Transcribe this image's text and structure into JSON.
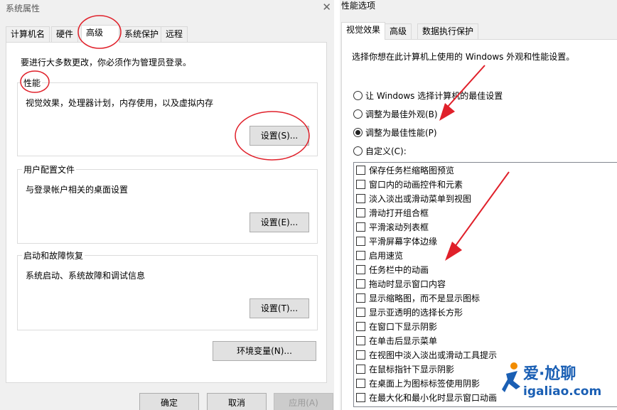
{
  "system_properties": {
    "title": "系统属性",
    "tabs": [
      "计算机名",
      "硬件",
      "高级",
      "系统保护",
      "远程"
    ],
    "admin_note": "要进行大多数更改，你必须作为管理员登录。",
    "performance": {
      "label": "性能",
      "description": "视觉效果，处理器计划，内存使用，以及虚拟内存",
      "button": "设置(S)..."
    },
    "user_profiles": {
      "label": "用户配置文件",
      "description": "与登录帐户相关的桌面设置",
      "button": "设置(E)..."
    },
    "startup_recovery": {
      "label": "启动和故障恢复",
      "description": "系统启动、系统故障和调试信息",
      "button": "设置(T)..."
    },
    "env_button": "环境变量(N)...",
    "footer": {
      "ok": "确定",
      "cancel": "取消",
      "apply": "应用(A)"
    }
  },
  "performance_options": {
    "title": "性能选项",
    "tabs": [
      "视觉效果",
      "高级",
      "数据执行保护"
    ],
    "intro": "选择你想在此计算机上使用的 Windows 外观和性能设置。",
    "radios": [
      {
        "label": "让 Windows 选择计算机的最佳设置",
        "checked": false
      },
      {
        "label": "调整为最佳外观(B)",
        "checked": false
      },
      {
        "label": "调整为最佳性能(P)",
        "checked": true
      },
      {
        "label": "自定义(C):",
        "checked": false
      }
    ],
    "options": [
      "保存任务栏缩略图预览",
      "窗口内的动画控件和元素",
      "淡入淡出或滑动菜单到视图",
      "滑动打开组合框",
      "平滑滚动列表框",
      "平滑屏幕字体边缘",
      "启用速览",
      "任务栏中的动画",
      "拖动时显示窗口内容",
      "显示缩略图，而不是显示图标",
      "显示亚透明的选择长方形",
      "在窗口下显示阴影",
      "在单击后显示菜单",
      "在视图中淡入淡出或滑动工具提示",
      "在鼠标指针下显示阴影",
      "在桌面上为图标标签使用阴影",
      "在最大化和最小化时显示窗口动画"
    ]
  },
  "watermark": {
    "text": "爱·尬聊",
    "url": "igaliao.com"
  },
  "colors": {
    "annotation_red": "#e0202a",
    "watermark_blue": "#1a5fb4",
    "watermark_orange": "#f28c00"
  }
}
